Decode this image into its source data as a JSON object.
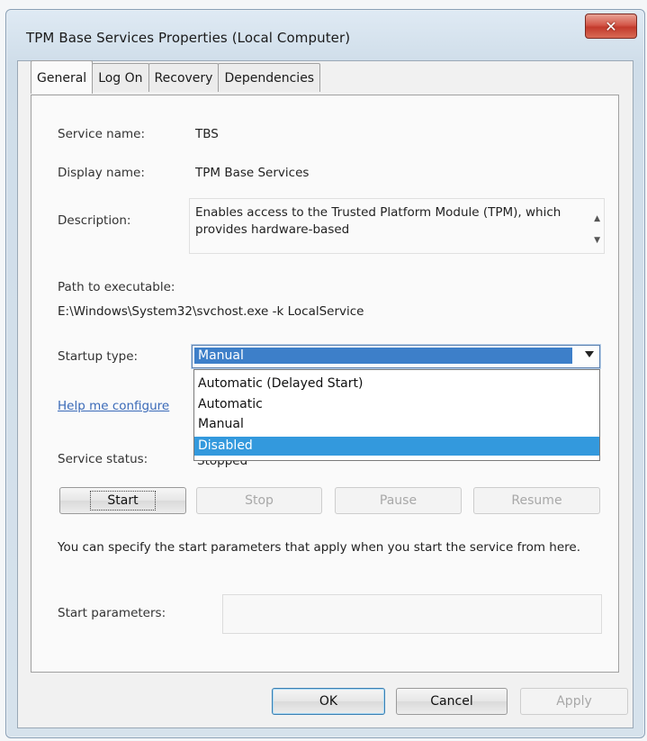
{
  "window": {
    "title": "TPM Base Services Properties (Local Computer)",
    "close_label": "✕"
  },
  "tabs": [
    {
      "label": "General",
      "active": true
    },
    {
      "label": "Log On",
      "active": false
    },
    {
      "label": "Recovery",
      "active": false
    },
    {
      "label": "Dependencies",
      "active": false
    }
  ],
  "general": {
    "service_name_label": "Service name:",
    "service_name_value": "TBS",
    "display_name_label": "Display name:",
    "display_name_value": "TPM Base Services",
    "description_label": "Description:",
    "description_value": "Enables access to the Trusted Platform Module (TPM), which provides hardware-based",
    "path_label": "Path to executable:",
    "path_value": "E:\\Windows\\System32\\svchost.exe -k LocalService",
    "startup_type_label": "Startup type:",
    "startup_type_value": "Manual",
    "startup_options": [
      "Automatic (Delayed Start)",
      "Automatic",
      "Manual",
      "Disabled"
    ],
    "startup_highlighted": "Disabled",
    "help_link": "Help me configure",
    "service_status_label": "Service status:",
    "service_status_value": "Stopped",
    "start_button": "Start",
    "stop_button": "Stop",
    "pause_button": "Pause",
    "resume_button": "Resume",
    "hint_text": "You can specify the start parameters that apply when you start the service from here.",
    "start_params_label": "Start parameters:",
    "start_params_value": ""
  },
  "footer": {
    "ok_button": "OK",
    "cancel_button": "Cancel",
    "apply_button": "Apply"
  },
  "colors": {
    "selection": "#3399dd",
    "link": "#3a6ab8",
    "close_button": "#c33a2c"
  }
}
